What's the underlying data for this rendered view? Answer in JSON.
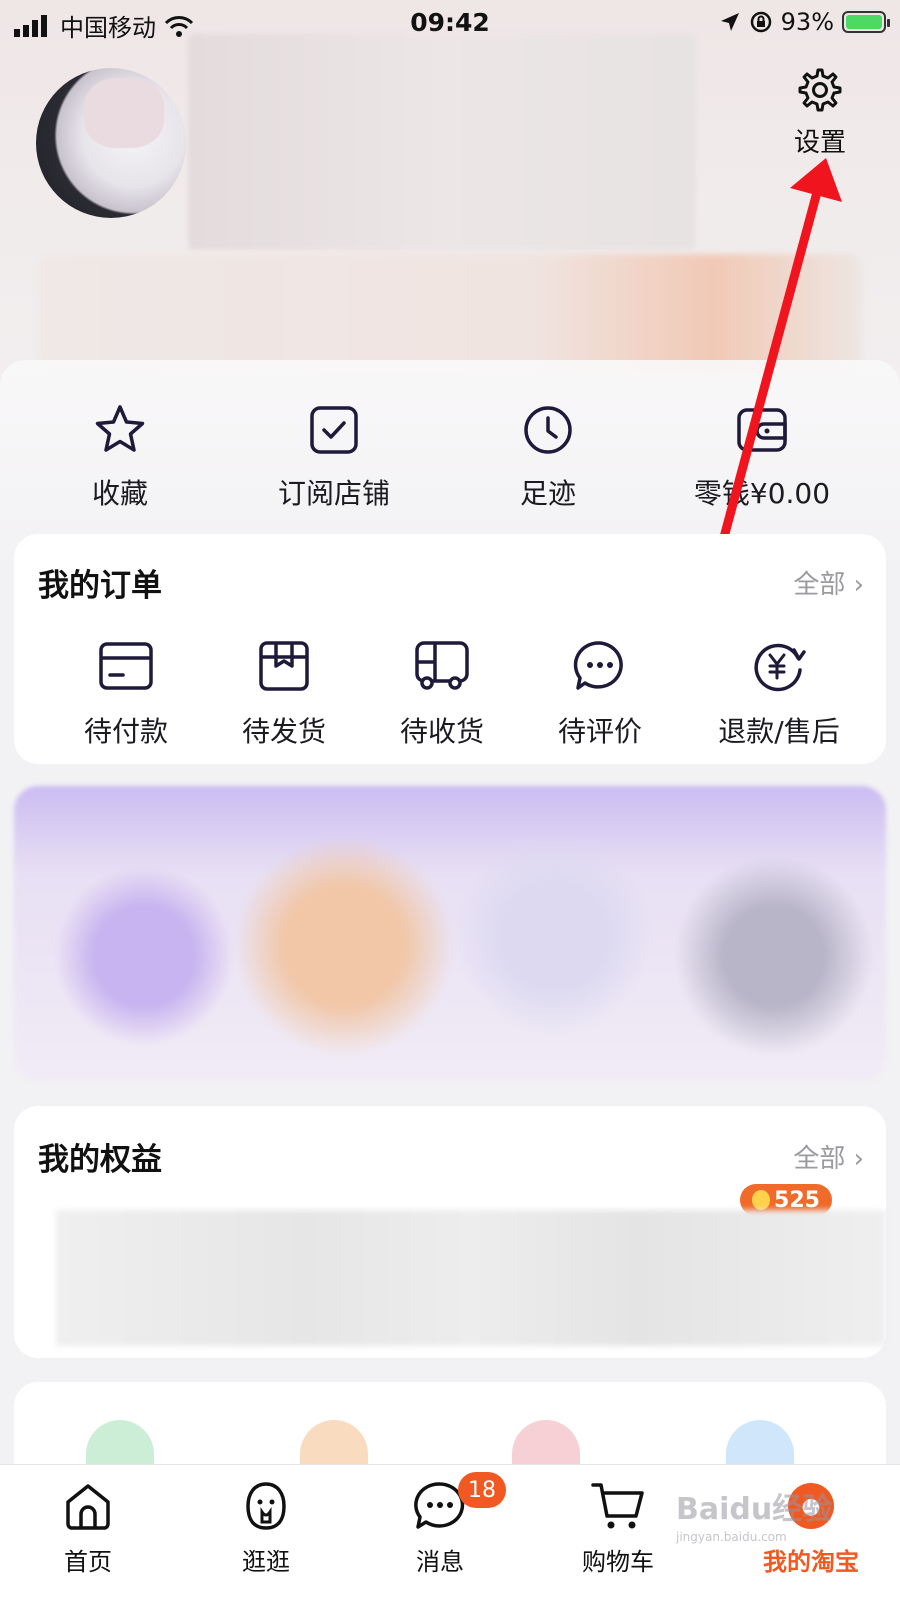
{
  "status_bar": {
    "carrier": "中国移动",
    "time": "09:42",
    "battery": "93%"
  },
  "header": {
    "settings_label": "设置"
  },
  "quick_links": [
    {
      "label": "收藏",
      "icon": "star-icon"
    },
    {
      "label": "订阅店铺",
      "icon": "checkbox-icon"
    },
    {
      "label": "足迹",
      "icon": "clock-icon"
    },
    {
      "label": "零钱¥0.00",
      "icon": "wallet-icon"
    }
  ],
  "orders": {
    "title": "我的订单",
    "more": "全部 ›",
    "items": [
      {
        "label": "待付款",
        "icon": "card-icon"
      },
      {
        "label": "待发货",
        "icon": "box-icon"
      },
      {
        "label": "待收货",
        "icon": "truck-icon"
      },
      {
        "label": "待评价",
        "icon": "chat-bubble-icon"
      },
      {
        "label": "退款/售后",
        "icon": "refund-icon"
      }
    ]
  },
  "rights": {
    "title": "我的权益",
    "more": "全部 ›",
    "coins": "525"
  },
  "tab_bar": {
    "items": [
      {
        "label": "首页",
        "icon": "home-icon"
      },
      {
        "label": "逛逛",
        "icon": "discover-icon"
      },
      {
        "label": "消息",
        "icon": "message-icon"
      },
      {
        "label": "购物车",
        "icon": "cart-icon"
      },
      {
        "label": "我的淘宝",
        "icon": "profile-icon"
      }
    ],
    "message_badge": "18",
    "active_index": 4
  },
  "watermark": {
    "text": "Baidu经验",
    "sub": "jingyan.baidu.com"
  },
  "colors": {
    "accent": "#f05a22",
    "annotation_arrow": "#f0141e",
    "icon_stroke": "#1e1a3a"
  }
}
